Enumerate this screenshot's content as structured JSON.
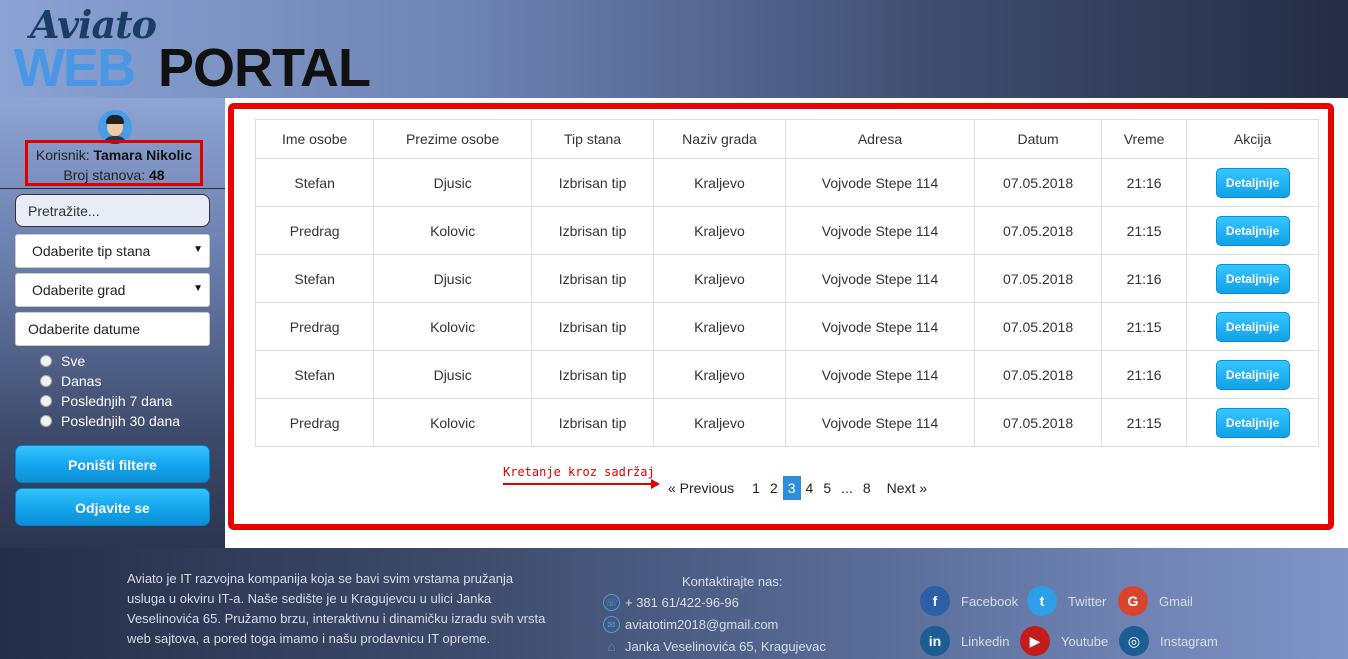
{
  "logo": {
    "line1": "Aviato",
    "line2a": "WEB",
    "line2b": "PORTAL"
  },
  "user": {
    "label": "Korisnik:",
    "name": "Tamara Nikolic",
    "count_label": "Broj stanova:",
    "count": "48"
  },
  "filters": {
    "search_placeholder": "Pretražite...",
    "type_select": "Odaberite tip stana",
    "city_select": "Odaberite grad",
    "date_select": "Odaberite datume",
    "radios": [
      "Sve",
      "Danas",
      "Poslednjih 7 dana",
      "Poslednjih 30 dana"
    ],
    "reset_label": "Poništi filtere",
    "logout_label": "Odjavite se"
  },
  "table": {
    "headers": [
      "Ime osobe",
      "Prezime osobe",
      "Tip stana",
      "Naziv grada",
      "Adresa",
      "Datum",
      "Vreme",
      "Akcija"
    ],
    "rows": [
      [
        "Stefan",
        "Djusic",
        "Izbrisan tip",
        "Kraljevo",
        "Vojvode Stepe 114",
        "07.05.2018",
        "21:16",
        "Detaljnije"
      ],
      [
        "Predrag",
        "Kolovic",
        "Izbrisan tip",
        "Kraljevo",
        "Vojvode Stepe 114",
        "07.05.2018",
        "21:15",
        "Detaljnije"
      ],
      [
        "Stefan",
        "Djusic",
        "Izbrisan tip",
        "Kraljevo",
        "Vojvode Stepe 114",
        "07.05.2018",
        "21:16",
        "Detaljnije"
      ],
      [
        "Predrag",
        "Kolovic",
        "Izbrisan tip",
        "Kraljevo",
        "Vojvode Stepe 114",
        "07.05.2018",
        "21:15",
        "Detaljnije"
      ],
      [
        "Stefan",
        "Djusic",
        "Izbrisan tip",
        "Kraljevo",
        "Vojvode Stepe 114",
        "07.05.2018",
        "21:16",
        "Detaljnije"
      ],
      [
        "Predrag",
        "Kolovic",
        "Izbrisan tip",
        "Kraljevo",
        "Vojvode Stepe 114",
        "07.05.2018",
        "21:15",
        "Detaljnije"
      ]
    ]
  },
  "pagination": {
    "annotation": "Kretanje kroz sadržaj",
    "prev": "«  Previous",
    "pages": [
      "1",
      "2",
      "3",
      "4",
      "5",
      "...",
      "8"
    ],
    "active_page": "3",
    "next": "Next  »"
  },
  "footer": {
    "about": "Aviato je IT razvojna kompanija koja se bavi svim vrstama pružanja usluga u okviru IT-a. Naše sedište je u Kragujevcu u ulici Janka Veselinovića 65. Pružamo brzu, interaktivnu i dinamičku izradu svih vrsta web sajtova, a pored toga imamo i našu prodavnicu IT opreme.",
    "contact_title": "Kontaktirajte nas:",
    "phone": "+ 381 61/422-96-96",
    "email": "aviatotim2018@gmail.com",
    "address": "Janka Veselinovića 65, Kragujevac",
    "social": [
      {
        "label": "Facebook",
        "icon": "facebook-icon",
        "glyph": "f",
        "color": "#2c5fa8"
      },
      {
        "label": "Twitter",
        "icon": "twitter-icon",
        "glyph": "t",
        "color": "#2d9fe8"
      },
      {
        "label": "Gmail",
        "icon": "google-icon",
        "glyph": "G",
        "color": "#d9452c"
      },
      {
        "label": "Linkedin",
        "icon": "linkedin-icon",
        "glyph": "in",
        "color": "#1c5d94"
      },
      {
        "label": "Youtube",
        "icon": "youtube-icon",
        "glyph": "▶",
        "color": "#c41c1c"
      },
      {
        "label": "Instagram",
        "icon": "instagram-icon",
        "glyph": "◎",
        "color": "#1c5d94"
      }
    ]
  }
}
